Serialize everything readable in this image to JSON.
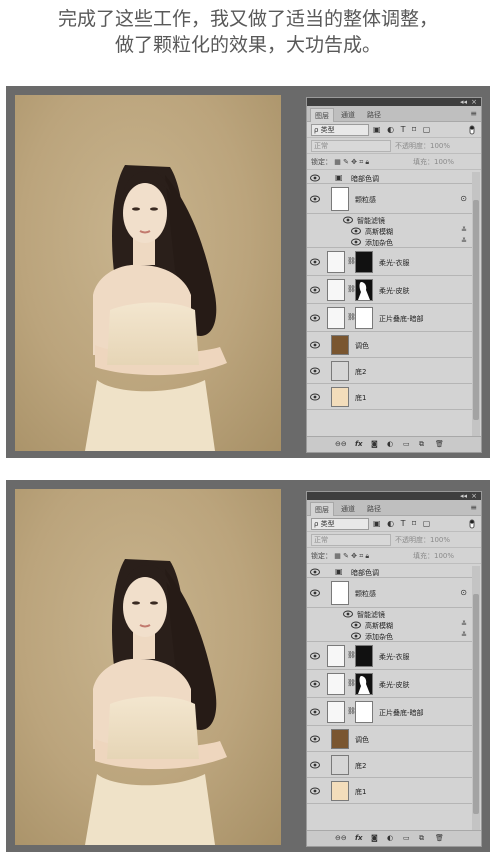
{
  "caption": {
    "line1": "完成了这些工作，我又做了适当的整体调整，",
    "line2": "做了颗粒化的效果，大功告成。"
  },
  "panel": {
    "collapse_label": "◂◂",
    "close_label": "×",
    "tabs": [
      "图层",
      "通道",
      "路径"
    ],
    "menu_icon": "menu-icon",
    "kind_label": "ρ 类型",
    "filter_icons": "▣ ◐ T ⌑ ▢",
    "blend_mode": "正常",
    "opacity_label": "不透明度：",
    "opacity_value": "100%",
    "lock_label": "锁定：",
    "fill_label": "填充：",
    "fill_value": "100%",
    "layers": {
      "dark_adjust": "暗部色调",
      "grain": "颗粒感",
      "smart_filter": "智能滤镜",
      "gaussian": "高斯模糊",
      "noise": "添加杂色",
      "soft_clothes": "柔光-衣服",
      "soft_skin": "柔光-皮肤",
      "multiply": "正片叠底-暗部",
      "tone": "调色",
      "base2": "底2",
      "base1": "底1"
    },
    "bottom_icons": [
      "link-icon",
      "fx-icon",
      "mask-icon",
      "adjustment-icon",
      "group-icon",
      "new-layer-icon",
      "trash-icon"
    ]
  },
  "colors": {
    "tone_swatch": "#7a5630",
    "base2_swatch": "#d6d6d6",
    "base1_swatch": "#f3ddbb"
  }
}
